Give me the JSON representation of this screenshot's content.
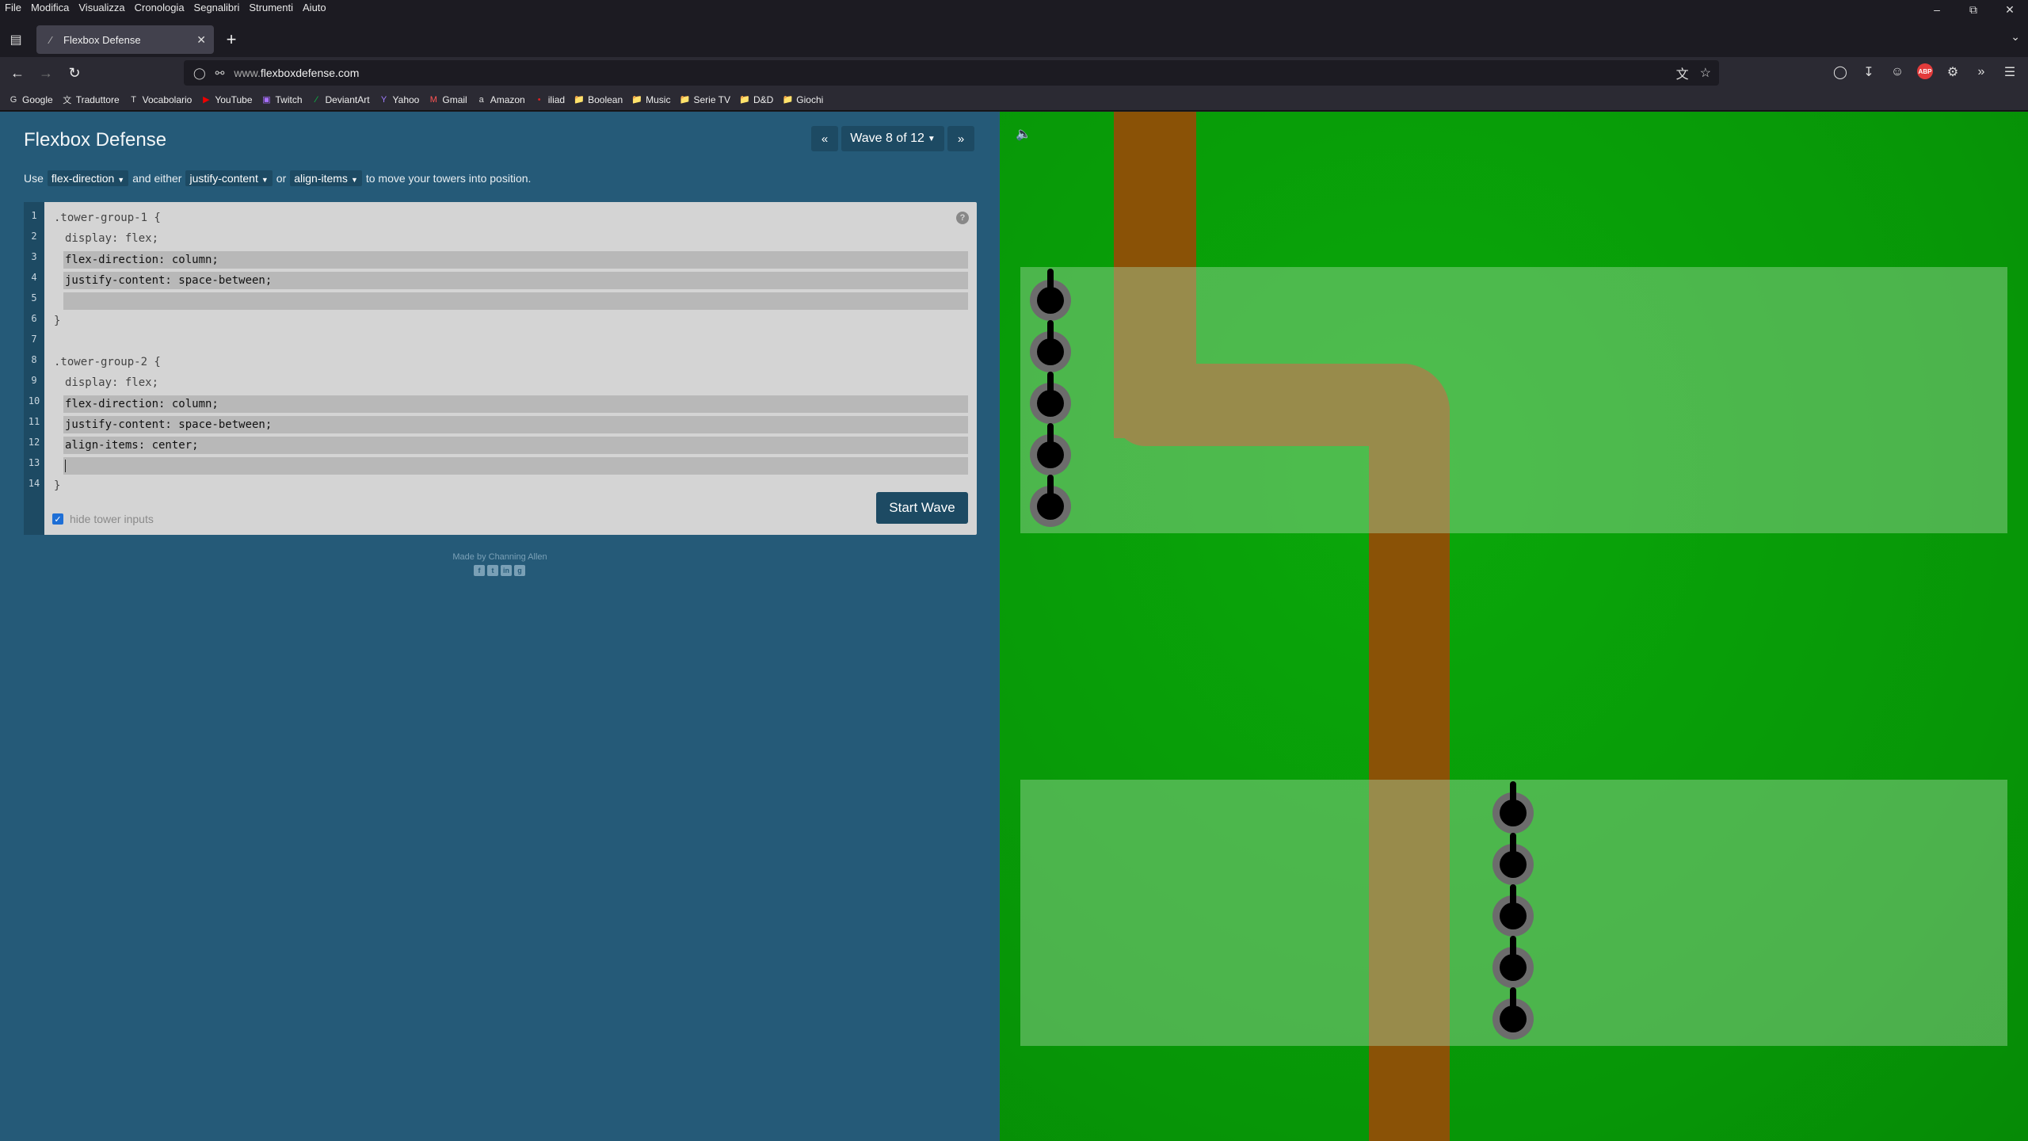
{
  "browser": {
    "menu": [
      "File",
      "Modifica",
      "Visualizza",
      "Cronologia",
      "Segnalibri",
      "Strumenti",
      "Aiuto"
    ],
    "tab_title": "Flexbox Defense",
    "url_host": "www.",
    "url_domain": "flexboxdefense.com",
    "bookmarks": [
      "Google",
      "Traduttore",
      "Vocabolario",
      "YouTube",
      "Twitch",
      "DeviantArt",
      "Yahoo",
      "Gmail",
      "Amazon",
      "iliad",
      "Boolean",
      "Music",
      "Serie TV",
      "D&D",
      "Giochi"
    ]
  },
  "game": {
    "title": "Flexbox Defense",
    "wave_label": "Wave 8 of 12",
    "instructions": {
      "use": "Use",
      "prop1": "flex-direction",
      "and_either": "and either",
      "prop2": "justify-content",
      "or": "or",
      "prop3": "align-items",
      "tail": "to move your towers into position."
    },
    "code": {
      "line_numbers": [
        "1",
        "2",
        "3",
        "4",
        "5",
        "6",
        "7",
        "8",
        "9",
        "10",
        "11",
        "12",
        "13",
        "14"
      ],
      "group1_selector": ".tower-group-1 {",
      "group1_display": "display: flex;",
      "group1_inputs": [
        "flex-direction: column;",
        "justify-content: space-between;",
        ""
      ],
      "close_brace": "}",
      "group2_selector": ".tower-group-2 {",
      "group2_display": "display: flex;",
      "group2_inputs": [
        "flex-direction: column;",
        "justify-content: space-between;",
        "align-items: center;",
        ""
      ]
    },
    "hide_inputs_label": "hide tower inputs",
    "hide_inputs_checked": true,
    "start_button": "Start Wave",
    "credit": "Made by Channing Allen"
  },
  "colors": {
    "panel": "#255a78",
    "grass": "#089e08",
    "path": "#8a5206"
  }
}
